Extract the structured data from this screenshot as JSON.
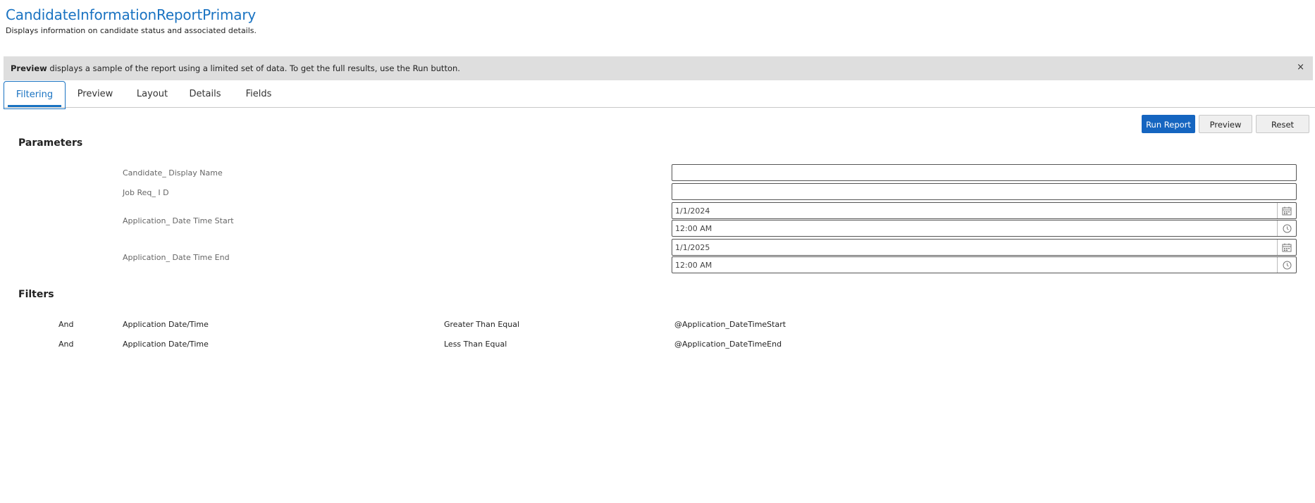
{
  "header": {
    "title": "CandidateInformationReportPrimary",
    "subtitle": "Displays information on candidate status and associated details."
  },
  "banner": {
    "bold": "Preview",
    "text": " displays a sample of the report using a limited set of data. To get the full results, use the Run button.",
    "close": "×"
  },
  "tabs": [
    "Filtering",
    "Preview",
    "Layout",
    "Details",
    "Fields"
  ],
  "actions": {
    "run": "Run Report",
    "preview": "Preview",
    "reset": "Reset"
  },
  "parameters": {
    "heading": "Parameters",
    "candidate_name": {
      "label": "Candidate_ Display Name",
      "value": ""
    },
    "job_req": {
      "label": "Job Req_ I D",
      "value": ""
    },
    "start": {
      "label": "Application_ Date Time Start",
      "date": "1/1/2024",
      "time": "12:00 AM"
    },
    "end": {
      "label": "Application_ Date Time End",
      "date": "1/1/2025",
      "time": "12:00 AM"
    }
  },
  "filters": {
    "heading": "Filters",
    "rows": [
      {
        "op": "And",
        "field": "Application Date/Time",
        "condition": "Greater Than Equal",
        "value": "@Application_DateTimeStart"
      },
      {
        "op": "And",
        "field": "Application Date/Time",
        "condition": "Less Than Equal",
        "value": "@Application_DateTimeEnd"
      }
    ]
  },
  "colors": {
    "accent": "#1a73c2",
    "primary_button": "#1565c0",
    "banner_bg": "#dedede"
  }
}
